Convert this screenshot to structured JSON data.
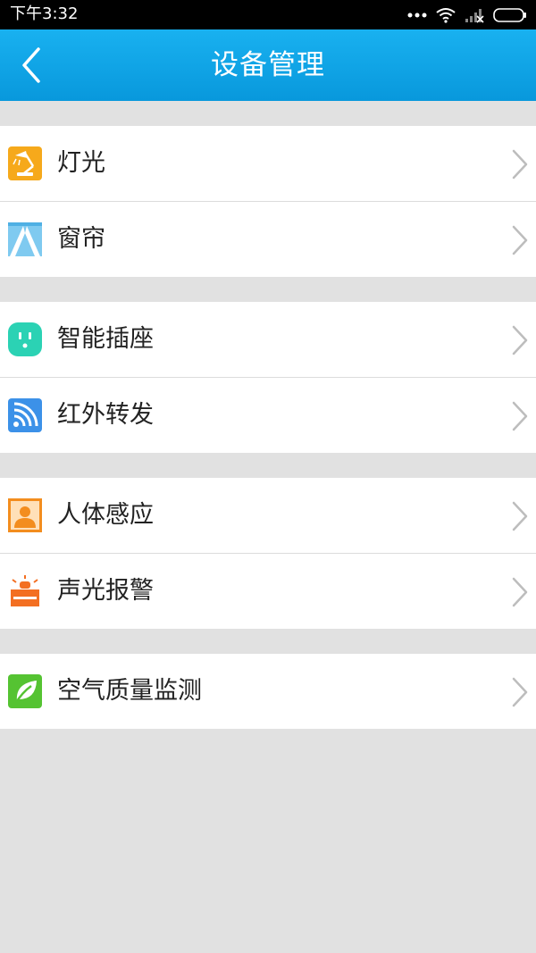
{
  "status_bar": {
    "time": "下午3:32"
  },
  "header": {
    "title": "设备管理"
  },
  "groups": [
    {
      "items": [
        {
          "label": "灯光",
          "icon": "lamp-icon",
          "color": "#f6a91b"
        },
        {
          "label": "窗帘",
          "icon": "curtain-icon",
          "color": "#7fcaf0"
        }
      ]
    },
    {
      "items": [
        {
          "label": "智能插座",
          "icon": "socket-icon",
          "color": "#2bd2b4"
        },
        {
          "label": "红外转发",
          "icon": "infrared-icon",
          "color": "#3c91e8"
        }
      ]
    },
    {
      "items": [
        {
          "label": "人体感应",
          "icon": "human-sensor-icon",
          "color": "#f38d1e"
        },
        {
          "label": "声光报警",
          "icon": "alarm-icon",
          "color": "#f36f22"
        }
      ]
    },
    {
      "items": [
        {
          "label": "空气质量监测",
          "icon": "leaf-icon",
          "color": "#55c332"
        }
      ]
    }
  ]
}
